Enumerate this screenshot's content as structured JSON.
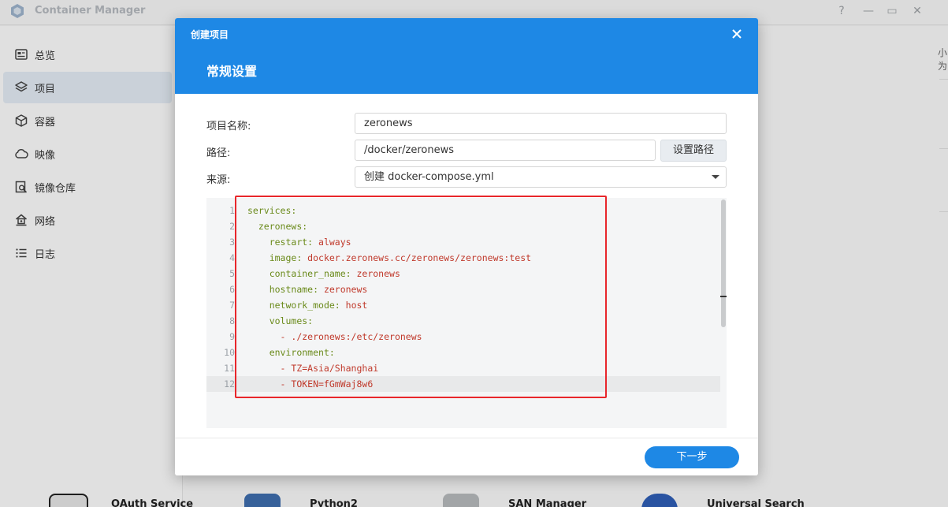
{
  "app": {
    "title": "Container Manager",
    "controls": {
      "help": "?",
      "minimize": "—",
      "maximize": "▭",
      "close": "✕"
    }
  },
  "sidebar": {
    "items": [
      {
        "label": "总览",
        "icon": "overview-icon",
        "active": false
      },
      {
        "label": "项目",
        "icon": "layers-icon",
        "active": true
      },
      {
        "label": "容器",
        "icon": "cube-icon",
        "active": false
      },
      {
        "label": "映像",
        "icon": "cloud-icon",
        "active": false
      },
      {
        "label": "镜像仓库",
        "icon": "registry-search-icon",
        "active": false
      },
      {
        "label": "网络",
        "icon": "network-icon",
        "active": false
      },
      {
        "label": "日志",
        "icon": "log-list-icon",
        "active": false
      }
    ]
  },
  "background": {
    "right_cut_text": "小为",
    "packages": [
      "OAuth Service",
      "Python2",
      "SAN Manager",
      "Universal Search"
    ]
  },
  "dialog": {
    "small_title": "创建项目",
    "section_title": "常规设置",
    "close_icon": "close-icon",
    "fields": {
      "name_label": "项目名称:",
      "name_value": "zeronews",
      "path_label": "路径:",
      "path_value": "/docker/zeronews",
      "set_path_button": "设置路径",
      "source_label": "来源:",
      "source_value": "创建 docker-compose.yml"
    },
    "editor": {
      "lines": [
        {
          "n": "1",
          "indent": "",
          "key": "services:",
          "value": ""
        },
        {
          "n": "2",
          "indent": "  ",
          "key": "zeronews:",
          "value": ""
        },
        {
          "n": "3",
          "indent": "    ",
          "key": "restart:",
          "value": " always"
        },
        {
          "n": "4",
          "indent": "    ",
          "key": "image:",
          "value": " docker.zeronews.cc/zeronews/zeronews:test"
        },
        {
          "n": "5",
          "indent": "    ",
          "key": "container_name:",
          "value": " zeronews"
        },
        {
          "n": "6",
          "indent": "    ",
          "key": "hostname:",
          "value": " zeronews"
        },
        {
          "n": "7",
          "indent": "    ",
          "key": "network_mode:",
          "value": " host"
        },
        {
          "n": "8",
          "indent": "    ",
          "key": "volumes:",
          "value": ""
        },
        {
          "n": "9",
          "indent": "      ",
          "key": "",
          "value": "- ./zeronews:/etc/zeronews"
        },
        {
          "n": "10",
          "indent": "    ",
          "key": "environment:",
          "value": ""
        },
        {
          "n": "11",
          "indent": "      ",
          "key": "",
          "value": "- TZ=Asia/Shanghai"
        },
        {
          "n": "12",
          "indent": "      ",
          "key": "",
          "value": "- TOKEN=fGmWaj8w6"
        }
      ],
      "highlighted_line": 12
    },
    "next_button": "下一步"
  },
  "colors": {
    "accent": "#1e88e5",
    "highlight_box": "#e8262b",
    "yaml_key": "#6a8a1a",
    "yaml_value": "#c0392b"
  }
}
